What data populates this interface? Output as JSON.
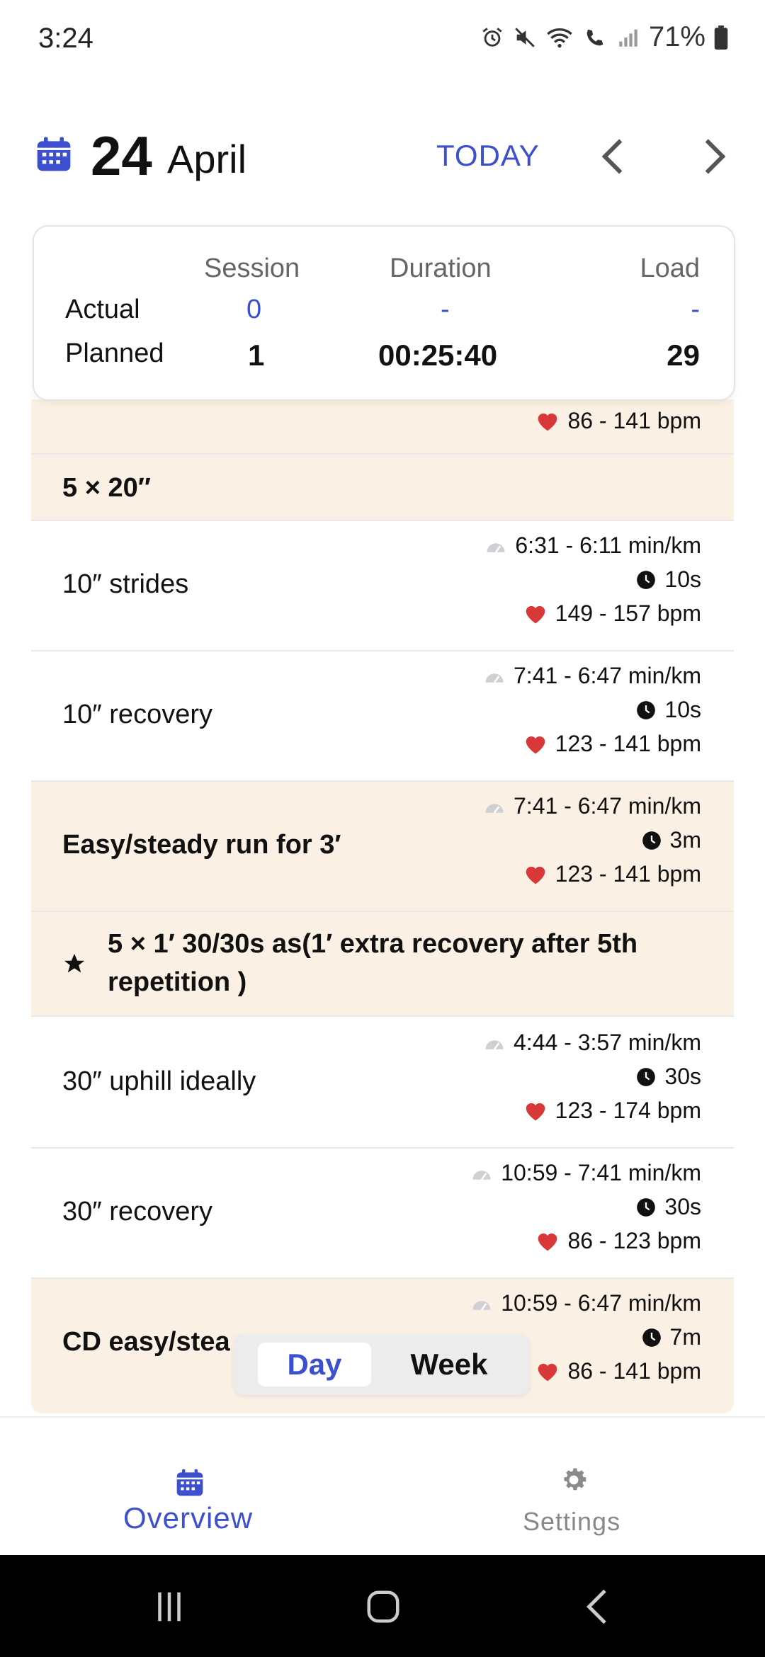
{
  "status_bar": {
    "time": "3:24",
    "battery": "71%"
  },
  "header": {
    "day": "24",
    "month": "April",
    "today_label": "TODAY"
  },
  "summary": {
    "col_session": "Session",
    "col_duration": "Duration",
    "col_load": "Load",
    "actual_label": "Actual",
    "planned_label": "Planned",
    "actual_session": "0",
    "actual_duration": "-",
    "actual_load": "-",
    "planned_session": "1",
    "planned_duration": "00:25:40",
    "planned_load": "29"
  },
  "rows": [
    {
      "type": "partial",
      "hr": "86 - 141 bpm"
    },
    {
      "type": "group",
      "title": "5 × 20″"
    },
    {
      "type": "step",
      "title": "10″ strides",
      "pace": "6:31 - 6:11 min/km",
      "time": "10s",
      "hr": "149 - 157 bpm"
    },
    {
      "type": "step",
      "title": "10″ recovery",
      "pace": "7:41 - 6:47 min/km",
      "time": "10s",
      "hr": "123 - 141 bpm"
    },
    {
      "type": "block",
      "title": "Easy/steady run for 3′",
      "pace": "7:41 - 6:47 min/km",
      "time": "3m",
      "hr": "123 - 141 bpm"
    },
    {
      "type": "group",
      "title_line1": "5 × 1′ 30/30s as(1′ extra recovery after 5th",
      "title_line2": "repetition  )"
    },
    {
      "type": "step",
      "title": "30″ uphill ideally",
      "pace": "4:44 - 3:57 min/km",
      "time": "30s",
      "hr": "123 - 174 bpm"
    },
    {
      "type": "step",
      "title": "30″ recovery",
      "pace": "10:59 - 7:41 min/km",
      "time": "30s",
      "hr": "86 - 123 bpm"
    },
    {
      "type": "block",
      "title": "CD easy/stea",
      "pace": "10:59 - 6:47 min/km",
      "time": "7m",
      "hr": "86 - 141 bpm"
    }
  ],
  "toggle": {
    "day_label": "Day",
    "week_label": "Week"
  },
  "bottom_nav": {
    "overview_label": "Overview",
    "settings_label": "Settings"
  },
  "colors": {
    "accent": "#3b4fcf",
    "beige": "#faf0e3",
    "heart": "#d93838"
  }
}
